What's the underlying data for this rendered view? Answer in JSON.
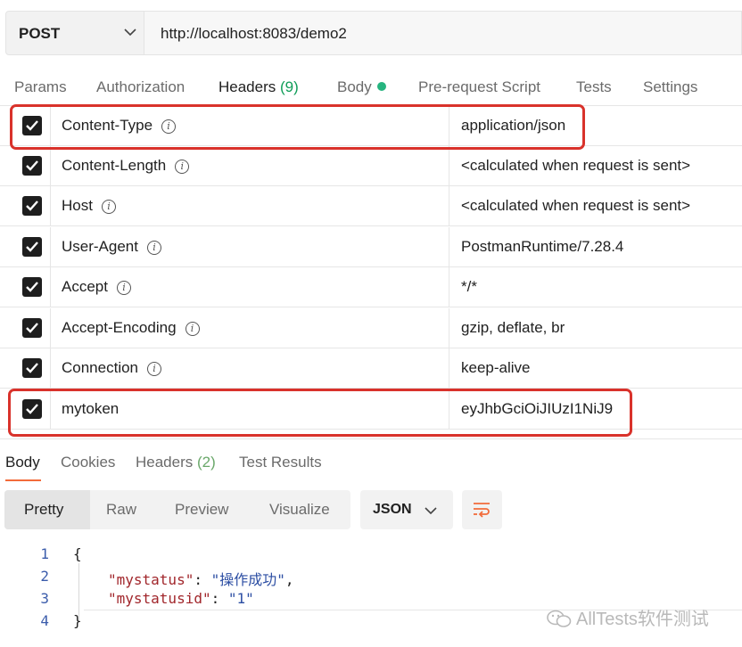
{
  "request": {
    "method": "POST",
    "url": "http://localhost:8083/demo2"
  },
  "request_tabs": {
    "params": "Params",
    "authorization": "Authorization",
    "headers": "Headers",
    "headers_count": "(9)",
    "body": "Body",
    "pre_request": "Pre-request Script",
    "tests": "Tests",
    "settings": "Settings"
  },
  "headers": [
    {
      "key": "Content-Type",
      "value": "application/json",
      "checked": true
    },
    {
      "key": "Content-Length",
      "value": "<calculated when request is sent>",
      "checked": true
    },
    {
      "key": "Host",
      "value": "<calculated when request is sent>",
      "checked": true
    },
    {
      "key": "User-Agent",
      "value": "PostmanRuntime/7.28.4",
      "checked": true
    },
    {
      "key": "Accept",
      "value": "*/*",
      "checked": true
    },
    {
      "key": "Accept-Encoding",
      "value": "gzip, deflate, br",
      "checked": true
    },
    {
      "key": "Connection",
      "value": "keep-alive",
      "checked": true
    },
    {
      "key": "mytoken",
      "value": "eyJhbGciOiJIUzI1NiJ9",
      "checked": true
    }
  ],
  "info_glyph": "i",
  "response_tabs": {
    "body": "Body",
    "cookies": "Cookies",
    "headers": "Headers",
    "headers_count": "(2)",
    "test_results": "Test Results"
  },
  "view_modes": {
    "pretty": "Pretty",
    "raw": "Raw",
    "preview": "Preview",
    "visualize": "Visualize"
  },
  "format": "JSON",
  "code": {
    "line_numbers": [
      "1",
      "2",
      "3",
      "4"
    ],
    "open_brace": "{",
    "close_brace": "}",
    "key1": "\"mystatus\"",
    "val1": "\"操作成功\"",
    "key2": "\"mystatusid\"",
    "val2": "\"1\"",
    "colon": ":",
    "comma": ","
  },
  "watermark": "AllTests软件测试",
  "colors": {
    "accent_tab": "#f26b3a",
    "highlight": "#d9322b",
    "body_dot": "#26b47f"
  }
}
